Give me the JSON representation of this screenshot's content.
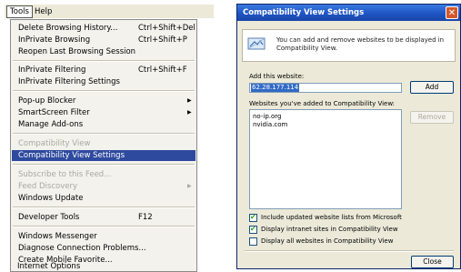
{
  "menubar": {
    "items": [
      {
        "label": "Tools",
        "active": true
      },
      {
        "label": "Help",
        "active": false
      }
    ]
  },
  "tools_menu": {
    "items": [
      {
        "label": "Delete Browsing History...",
        "shortcut": "Ctrl+Shift+Del"
      },
      {
        "label": "InPrivate Browsing",
        "shortcut": "Ctrl+Shift+P"
      },
      {
        "label": "Reopen Last Browsing Session"
      },
      {
        "label": "InPrivate Filtering",
        "shortcut": "Ctrl+Shift+F"
      },
      {
        "label": "InPrivate Filtering Settings"
      },
      {
        "label": "Pop-up Blocker",
        "submenu": true
      },
      {
        "label": "SmartScreen Filter",
        "submenu": true
      },
      {
        "label": "Manage Add-ons"
      },
      {
        "label": "Compatibility View",
        "disabled": true
      },
      {
        "label": "Compatibility View Settings",
        "highlighted": true
      },
      {
        "label": "Subscribe to this Feed...",
        "disabled": true
      },
      {
        "label": "Feed Discovery",
        "disabled": true,
        "submenu": true
      },
      {
        "label": "Windows Update"
      },
      {
        "label": "Developer Tools",
        "shortcut": "F12"
      },
      {
        "label": "Windows Messenger"
      },
      {
        "label": "Diagnose Connection Problems..."
      },
      {
        "label": "Create Mobile Favorite..."
      },
      {
        "label": "Internet Options"
      }
    ],
    "submenu_arrow": "▶"
  },
  "dialog": {
    "title": "Compatibility View Settings",
    "close_glyph": "✕",
    "info_icon": "compatibility-view-icon",
    "info_text": "You can add and remove websites to be displayed in Compatibility View.",
    "add_label": "Add this website:",
    "add_value": "62.28.177.114",
    "add_button": "Add",
    "list_label": "Websites you've added to Compatibility View:",
    "sites": [
      "no-ip.org",
      "nvidia.com"
    ],
    "remove_button": "Remove",
    "options": [
      {
        "label": "Include updated website lists from Microsoft",
        "checked": true
      },
      {
        "label": "Display intranet sites in Compatibility View",
        "checked": true
      },
      {
        "label": "Display all websites in Compatibility View",
        "checked": false
      }
    ],
    "check_glyph": "✔",
    "close_button": "Close"
  },
  "colors": {
    "menu_highlight": "#2e4a9e",
    "titlebar": "#1f54c4",
    "input_selection": "#316ac5"
  }
}
